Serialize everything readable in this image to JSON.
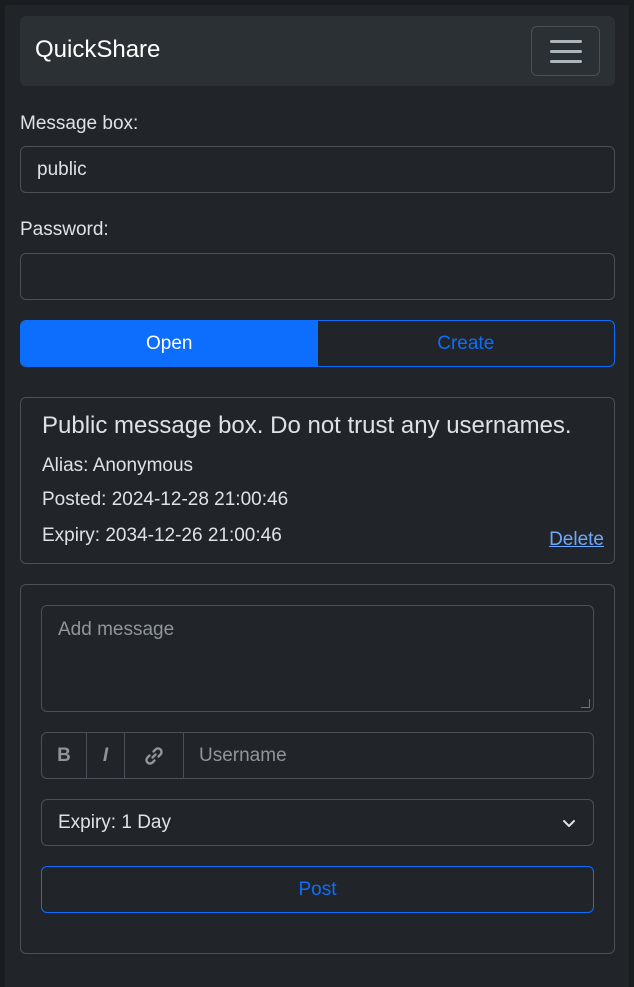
{
  "navbar": {
    "brand": "QuickShare",
    "menu_icon": "hamburger-menu-icon"
  },
  "form": {
    "message_box_label": "Message box:",
    "message_box_value": "public",
    "password_label": "Password:",
    "password_value": "",
    "open_label": "Open",
    "create_label": "Create"
  },
  "message": {
    "title": "Public message box. Do not trust any usernames.",
    "alias": "Alias: Anonymous",
    "posted": "Posted: 2024-12-28 21:00:46",
    "expiry": "Expiry: 2034-12-26 21:00:46",
    "delete_label": "Delete"
  },
  "compose": {
    "message_placeholder": "Add message",
    "bold_label": "B",
    "italic_label": "I",
    "link_icon": "link-icon",
    "username_placeholder": "Username",
    "expiry_value": "Expiry: 1 Day",
    "post_label": "Post"
  },
  "colors": {
    "background": "#212529",
    "accent": "#0d6efd",
    "link": "#6ea8fe",
    "border": "#495057"
  }
}
